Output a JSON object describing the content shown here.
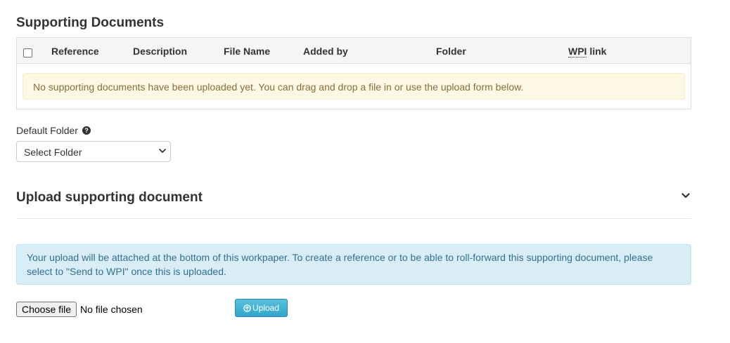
{
  "supporting_documents": {
    "title": "Supporting Documents",
    "columns": {
      "reference": "Reference",
      "description": "Description",
      "file_name": "File Name",
      "added_by": "Added by",
      "folder": "Folder",
      "wpi_abbr": "WPI",
      "wpi_suffix": " link"
    },
    "select_all_checked": false,
    "empty_message": "No supporting documents have been uploaded yet. You can drag and drop a file in or use the upload form below."
  },
  "default_folder": {
    "label": "Default Folder",
    "help_icon": "question-circle-icon",
    "selected": "Select Folder"
  },
  "upload_section": {
    "title": "Upload supporting document",
    "collapse_icon": "chevron-down-icon",
    "info_message": "Your upload will be attached at the bottom of this workpaper. To create a reference or to be able to roll-forward this supporting document, please select to \"Send to WPI\" once this is uploaded.",
    "choose_file_label": "Choose file",
    "file_status": "No file chosen",
    "upload_button_label": "Upload",
    "upload_icon": "arrow-up-circle-icon"
  },
  "colors": {
    "warning_bg": "#fcf8e3",
    "warning_text": "#8a6d3b",
    "info_bg": "#d9edf7",
    "info_text": "#31708f",
    "upload_button": "#5bc0de"
  }
}
